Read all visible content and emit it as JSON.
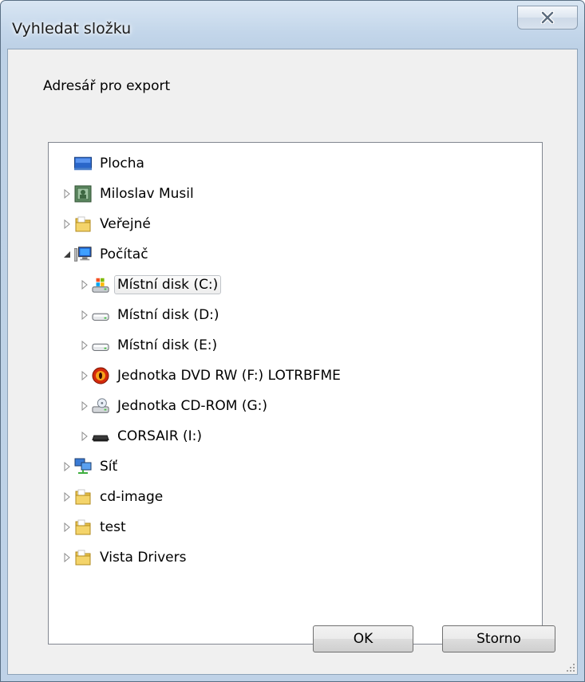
{
  "window": {
    "title": "Vyhledat složku",
    "close_icon": "close-x-icon"
  },
  "instruction": "Adresář pro export",
  "tree": {
    "items": [
      {
        "label": "Plocha",
        "icon": "desktop-icon",
        "expander": "none",
        "selected": false
      },
      {
        "label": "Miloslav Musil",
        "icon": "user-folder-icon",
        "expander": "collapsed",
        "selected": false
      },
      {
        "label": "Veřejné",
        "icon": "folder-icon",
        "expander": "collapsed",
        "selected": false
      },
      {
        "label": "Počítač",
        "icon": "computer-icon",
        "expander": "expanded",
        "selected": false
      },
      {
        "label": "Místní disk (C:)",
        "icon": "system-drive-icon",
        "expander": "collapsed",
        "selected": true
      },
      {
        "label": "Místní disk (D:)",
        "icon": "hard-drive-icon",
        "expander": "collapsed",
        "selected": false
      },
      {
        "label": "Místní disk (E:)",
        "icon": "hard-drive-icon",
        "expander": "collapsed",
        "selected": false
      },
      {
        "label": "Jednotka DVD RW (F:) LOTRBFME",
        "icon": "dvd-drive-icon",
        "expander": "collapsed",
        "selected": false
      },
      {
        "label": "Jednotka CD-ROM (G:)",
        "icon": "cd-drive-icon",
        "expander": "collapsed",
        "selected": false
      },
      {
        "label": "CORSAIR (I:)",
        "icon": "removable-drive-icon",
        "expander": "collapsed",
        "selected": false
      },
      {
        "label": "Síť",
        "icon": "network-icon",
        "expander": "collapsed",
        "selected": false
      },
      {
        "label": "cd-image",
        "icon": "folder-icon",
        "expander": "collapsed",
        "selected": false
      },
      {
        "label": "test",
        "icon": "folder-icon",
        "expander": "collapsed",
        "selected": false
      },
      {
        "label": "Vista Drivers",
        "icon": "folder-icon",
        "expander": "collapsed",
        "selected": false
      }
    ]
  },
  "buttons": {
    "ok": "OK",
    "cancel": "Storno"
  },
  "colors": {
    "title_bar": "#c3d6ea",
    "client_bg": "#f0f0f0",
    "tree_bg": "#ffffff",
    "folder": "#e8c24a"
  }
}
